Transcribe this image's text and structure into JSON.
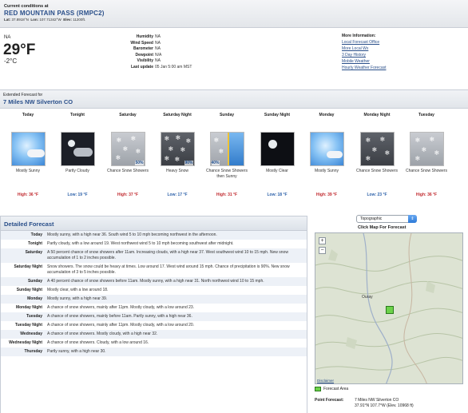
{
  "current": {
    "label": "Current conditions at",
    "station": "RED MOUNTAIN PASS (RMPC2)",
    "lat_label": "Lat:",
    "lat": "37.8918°N",
    "lon_label": "Lon:",
    "lon": "107.71342°W",
    "elev_label": "Elev:",
    "elev": "11200ft.",
    "condition": "NA",
    "temp_f": "29°F",
    "temp_c": "-2°C",
    "details": [
      {
        "label": "Humidity",
        "value": "NA"
      },
      {
        "label": "Wind Speed",
        "value": "NA"
      },
      {
        "label": "Barometer",
        "value": "NA"
      },
      {
        "label": "Dewpoint",
        "value": "N/A"
      },
      {
        "label": "Visibility",
        "value": "NA"
      },
      {
        "label": "Last update",
        "value": "05 Jan 5:00 am MST"
      }
    ]
  },
  "more_info": {
    "title": "More Information:",
    "links": [
      "Local Forecast Office",
      "More Local Wx",
      "3 Day History",
      "Mobile Weather",
      "Hourly Weather Forecast"
    ]
  },
  "extended": {
    "label": "Extended Forecast for",
    "location": "7 Miles NW Silverton CO",
    "periods": [
      {
        "name": "Today",
        "icon": "sunny-icon",
        "pct": "",
        "desc": "Mostly Sunny",
        "temp": "High: 36 °F",
        "kind": "hi"
      },
      {
        "name": "Tonight",
        "icon": "partly-cloudy-night-icon",
        "pct": "",
        "desc": "Partly Cloudy",
        "temp": "Low: 19 °F",
        "kind": "lo"
      },
      {
        "name": "Saturday",
        "icon": "snow-showers-icon",
        "pct": "50%",
        "desc": "Chance Snow Showers",
        "temp": "High: 37 °F",
        "kind": "hi"
      },
      {
        "name": "Saturday Night",
        "icon": "heavy-snow-icon",
        "pct": "90%",
        "desc": "Heavy Snow",
        "temp": "Low: 17 °F",
        "kind": "lo"
      },
      {
        "name": "Sunday",
        "icon": "snow-then-sunny-icon",
        "pct": "40%",
        "desc": "Chance Snow Showers then Sunny",
        "temp": "High: 31 °F",
        "kind": "hi"
      },
      {
        "name": "Sunday Night",
        "icon": "clear-night-icon",
        "pct": "",
        "desc": "Mostly Clear",
        "temp": "Low: 18 °F",
        "kind": "lo"
      },
      {
        "name": "Monday",
        "icon": "sunny-icon",
        "pct": "",
        "desc": "Mostly Sunny",
        "temp": "High: 39 °F",
        "kind": "hi"
      },
      {
        "name": "Monday Night",
        "icon": "snow-showers-night-icon",
        "pct": "",
        "desc": "Chance Snow Showers",
        "temp": "Low: 23 °F",
        "kind": "lo"
      },
      {
        "name": "Tuesday",
        "icon": "snow-showers-icon",
        "pct": "",
        "desc": "Chance Snow Showers",
        "temp": "High: 36 °F",
        "kind": "hi"
      }
    ]
  },
  "detailed": {
    "title": "Detailed Forecast",
    "rows": [
      {
        "name": "Today",
        "text": "Mostly sunny, with a high near 36. South wind 5 to 10 mph becoming northwest in the afternoon."
      },
      {
        "name": "Tonight",
        "text": "Partly cloudy, with a low around 19. West northwest wind 5 to 10 mph becoming southwest after midnight."
      },
      {
        "name": "Saturday",
        "text": "A 50 percent chance of snow showers after 11am. Increasing clouds, with a high near 37. West southwest wind 10 to 15 mph. New snow accumulation of 1 to 2 inches possible."
      },
      {
        "name": "Saturday Night",
        "text": "Snow showers. The snow could be heavy at times. Low around 17. West wind around 15 mph. Chance of precipitation is 90%. New snow accumulation of 3 to 5 inches possible."
      },
      {
        "name": "Sunday",
        "text": "A 40 percent chance of snow showers before 11am. Mostly sunny, with a high near 31. North northwest wind 10 to 15 mph."
      },
      {
        "name": "Sunday Night",
        "text": "Mostly clear, with a low around 18."
      },
      {
        "name": "Monday",
        "text": "Mostly sunny, with a high near 39."
      },
      {
        "name": "Monday Night",
        "text": "A chance of snow showers, mainly after 11pm. Mostly cloudy, with a low around 23."
      },
      {
        "name": "Tuesday",
        "text": "A chance of snow showers, mainly before 11am. Partly sunny, with a high near 36."
      },
      {
        "name": "Tuesday Night",
        "text": "A chance of snow showers, mainly after 11pm. Mostly cloudy, with a low around 20."
      },
      {
        "name": "Wednesday",
        "text": "A chance of snow showers. Mostly cloudy, with a high near 32."
      },
      {
        "name": "Wednesday Night",
        "text": "A chance of snow showers. Cloudy, with a low around 16."
      },
      {
        "name": "Thursday",
        "text": "Partly sunny, with a high near 30."
      }
    ]
  },
  "map": {
    "select_value": "Topographic",
    "hint": "Click Map For Forecast",
    "zoom_in": "+",
    "zoom_out": "−",
    "town": "Ouray",
    "attribution": "Disclaimer",
    "legend_label": "Forecast Area",
    "point_label": "Point Forecast:",
    "point_name": "7 Miles NW Silverton CO",
    "point_coords": "37.91°N 107.7°W (Elev. 10968 ft)",
    "marker_color": "#6cd24a"
  }
}
